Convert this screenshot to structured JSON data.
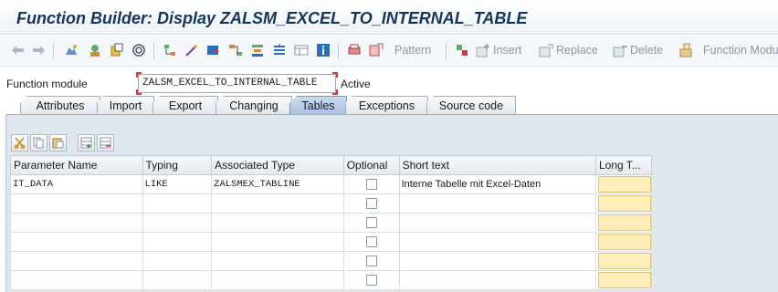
{
  "window": {
    "title": "Function Builder: Display ZALSM_EXCEL_TO_INTERNAL_TABLE"
  },
  "toolbar": {
    "pattern_label": "Pattern",
    "insert_label": "Insert",
    "replace_label": "Replace",
    "delete_label": "Delete",
    "function_module_label": "Function Modu"
  },
  "header": {
    "function_module_label": "Function module",
    "function_module_value": "ZALSM_EXCEL_TO_INTERNAL_TABLE",
    "status": "Active"
  },
  "tabs": [
    {
      "label": "Attributes"
    },
    {
      "label": "Import"
    },
    {
      "label": "Export"
    },
    {
      "label": "Changing"
    },
    {
      "label": "Tables"
    },
    {
      "label": "Exceptions"
    },
    {
      "label": "Source code"
    }
  ],
  "active_tab": "Tables",
  "table": {
    "columns": [
      "Parameter Name",
      "Typing",
      "Associated Type",
      "Optional",
      "Short text",
      "Long T..."
    ],
    "rows": [
      {
        "parameter_name": "IT_DATA",
        "typing": "LIKE",
        "associated_type": "ZALSMEX_TABLINE",
        "optional": false,
        "short_text": "Interne Tabelle mit Excel-Daten"
      },
      {
        "parameter_name": "",
        "typing": "",
        "associated_type": "",
        "optional": false,
        "short_text": ""
      },
      {
        "parameter_name": "",
        "typing": "",
        "associated_type": "",
        "optional": false,
        "short_text": ""
      },
      {
        "parameter_name": "",
        "typing": "",
        "associated_type": "",
        "optional": false,
        "short_text": ""
      },
      {
        "parameter_name": "",
        "typing": "",
        "associated_type": "",
        "optional": false,
        "short_text": ""
      },
      {
        "parameter_name": "",
        "typing": "",
        "associated_type": "",
        "optional": false,
        "short_text": ""
      }
    ]
  },
  "colors": {
    "title": "#15365c",
    "active_tab": "#a9c2e0",
    "long_text_button": "#ffeeb8",
    "panel": "#dfe7ee"
  }
}
